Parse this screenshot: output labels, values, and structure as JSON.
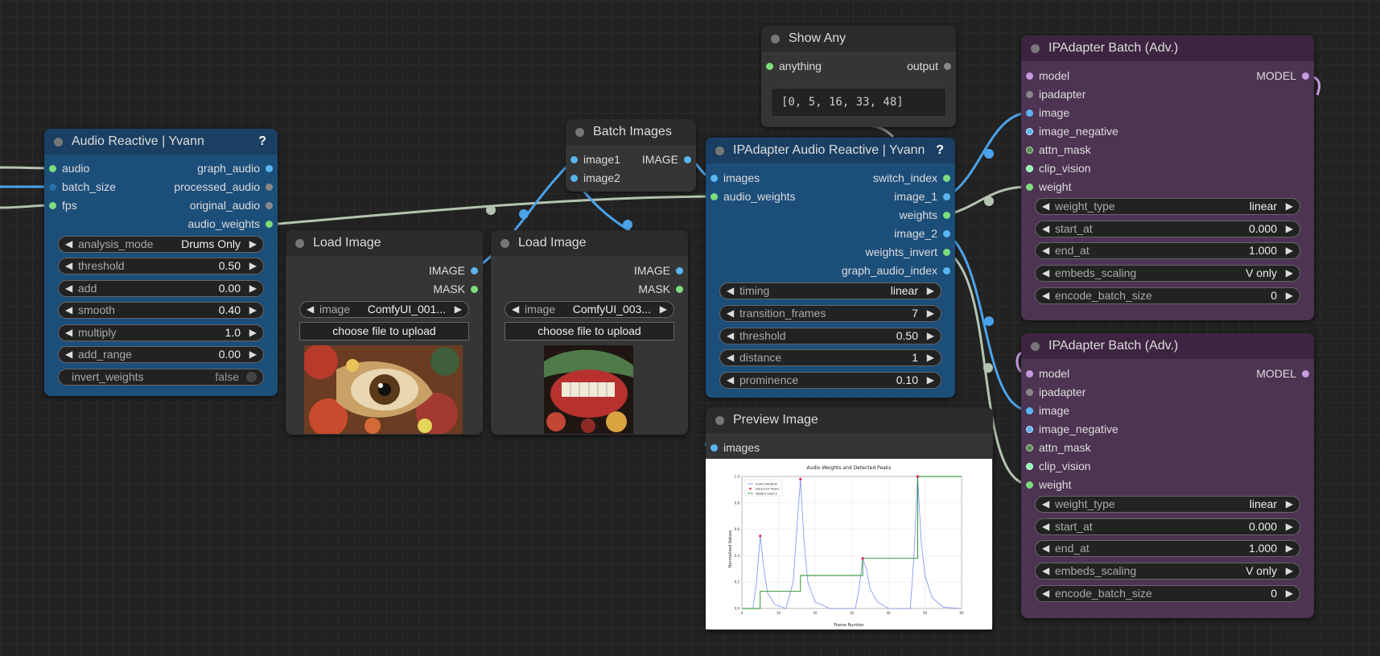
{
  "colors": {
    "canvas": "#222222",
    "wire_green": "#b5c4b0",
    "wire_blue": "#4aa3ea",
    "pin_green": "#7cdd7c",
    "pin_blue": "#5ab5f0",
    "pin_purple": "#c89ae0"
  },
  "audio_reactive": {
    "title": "Audio Reactive | Yvann",
    "help": "?",
    "inputs": [
      "audio",
      "batch_size",
      "fps"
    ],
    "outputs": [
      "graph_audio",
      "processed_audio",
      "original_audio",
      "audio_weights"
    ],
    "widgets": [
      {
        "label": "analysis_mode",
        "value": "Drums Only"
      },
      {
        "label": "threshold",
        "value": "0.50"
      },
      {
        "label": "add",
        "value": "0.00"
      },
      {
        "label": "smooth",
        "value": "0.40"
      },
      {
        "label": "multiply",
        "value": "1.0"
      },
      {
        "label": "add_range",
        "value": "0.00"
      }
    ],
    "toggle": {
      "label": "invert_weights",
      "value": "false"
    }
  },
  "load_image_1": {
    "title": "Load Image",
    "outputs": [
      "IMAGE",
      "MASK"
    ],
    "image_label": "image",
    "image_value": "ComfyUI_001...",
    "upload": "choose file to upload"
  },
  "load_image_2": {
    "title": "Load Image",
    "outputs": [
      "IMAGE",
      "MASK"
    ],
    "image_label": "image",
    "image_value": "ComfyUI_003...",
    "upload": "choose file to upload"
  },
  "batch_images": {
    "title": "Batch Images",
    "inputs": [
      "image1",
      "image2"
    ],
    "output": "IMAGE"
  },
  "show_any": {
    "title": "Show Any",
    "input": "anything",
    "output": "output",
    "text": "[0, 5, 16, 33, 48]"
  },
  "ipa_audio": {
    "title": "IPAdapter Audio Reactive | Yvann",
    "help": "?",
    "inputs": [
      "images",
      "audio_weights"
    ],
    "outputs": [
      "switch_index",
      "image_1",
      "weights",
      "image_2",
      "weights_invert",
      "graph_audio_index"
    ],
    "widgets": [
      {
        "label": "timing",
        "value": "linear"
      },
      {
        "label": "transition_frames",
        "value": "7"
      },
      {
        "label": "threshold",
        "value": "0.50"
      },
      {
        "label": "distance",
        "value": "1"
      },
      {
        "label": "prominence",
        "value": "0.10"
      }
    ]
  },
  "preview": {
    "title": "Preview Image",
    "input": "images"
  },
  "ipa_batch_1": {
    "title": "IPAdapter Batch (Adv.)",
    "inputs": [
      "model",
      "ipadapter",
      "image",
      "image_negative",
      "attn_mask",
      "clip_vision",
      "weight"
    ],
    "output": "MODEL",
    "widgets": [
      {
        "label": "weight_type",
        "value": "linear"
      },
      {
        "label": "start_at",
        "value": "0.000"
      },
      {
        "label": "end_at",
        "value": "1.000"
      },
      {
        "label": "embeds_scaling",
        "value": "V only"
      },
      {
        "label": "encode_batch_size",
        "value": "0"
      }
    ]
  },
  "ipa_batch_2": {
    "title": "IPAdapter Batch (Adv.)",
    "inputs": [
      "model",
      "ipadapter",
      "image",
      "image_negative",
      "attn_mask",
      "clip_vision",
      "weight"
    ],
    "output": "MODEL",
    "widgets": [
      {
        "label": "weight_type",
        "value": "linear"
      },
      {
        "label": "start_at",
        "value": "0.000"
      },
      {
        "label": "end_at",
        "value": "1.000"
      },
      {
        "label": "embeds_scaling",
        "value": "V only"
      },
      {
        "label": "encode_batch_size",
        "value": "0"
      }
    ]
  },
  "chart_data": {
    "type": "line",
    "title": "Audio Weights and Detected Peaks",
    "xlabel": "Frame Number",
    "ylabel": "Normalized Values",
    "xlim": [
      0,
      60
    ],
    "ylim": [
      0,
      1
    ],
    "xticks": [
      0,
      10,
      20,
      30,
      40,
      50,
      60
    ],
    "yticks": [
      "0.0",
      "0.2",
      "0.4",
      "0.6",
      "0.8",
      "1.0"
    ],
    "legend": [
      "Audio Weights",
      "Detected Peaks",
      "Weight Switch"
    ],
    "legend_position": "top-left",
    "peaks": {
      "x": [
        5,
        16,
        33,
        48
      ],
      "y": [
        0.55,
        0.98,
        0.38,
        1.0
      ]
    },
    "switch": {
      "x": [
        0,
        5,
        5,
        16,
        16,
        33,
        33,
        48,
        48,
        60
      ],
      "y": [
        0,
        0,
        0.13,
        0.13,
        0.25,
        0.25,
        0.38,
        0.38,
        1.0,
        1.0
      ]
    },
    "audio_weights": {
      "x": [
        0,
        3,
        4,
        5,
        6,
        7,
        9,
        12,
        14,
        15,
        16,
        17,
        18,
        20,
        24,
        31,
        32,
        33,
        34,
        35,
        37,
        40,
        46,
        47,
        48,
        49,
        50,
        52,
        55,
        60
      ],
      "y": [
        0,
        0,
        0.2,
        0.55,
        0.3,
        0.12,
        0.03,
        0,
        0.2,
        0.6,
        0.98,
        0.5,
        0.2,
        0.05,
        0,
        0,
        0.15,
        0.38,
        0.3,
        0.15,
        0.05,
        0,
        0,
        0.4,
        1.0,
        0.5,
        0.25,
        0.08,
        0.01,
        0
      ]
    }
  }
}
